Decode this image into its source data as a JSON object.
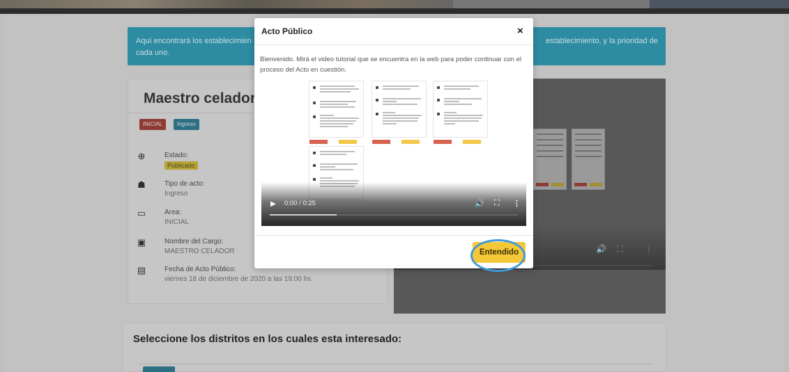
{
  "background": {
    "banner": {
      "text_left": "Aquí encontrará los establecimien",
      "text_left_line2": "cada uno.",
      "text_right": "establecimiento, y la prioridad de"
    },
    "card": {
      "title": "Maestro celador",
      "badges": [
        "INICIAL",
        "Ingreso"
      ],
      "details": [
        {
          "icon": "plus-circle-icon",
          "label": "Estado:",
          "value": "Publicado"
        },
        {
          "icon": "building-icon",
          "label": "Tipo de acto:",
          "value": "Ingreso"
        },
        {
          "icon": "monitor-icon",
          "label": "Area:",
          "value": "INICIAL"
        },
        {
          "icon": "suitcase-icon",
          "label": "Nombre del Cargo:",
          "value": "MAESTRO CELADOR"
        },
        {
          "icon": "calendar-icon",
          "label": "Fecha de Acto Público:",
          "value": "viernes 18 de diciembre de 2020 a las 19:00 hs."
        }
      ]
    },
    "districts_title": "Seleccione los distritos en los cuales esta interesado:"
  },
  "modal": {
    "title": "Acto Público",
    "close_label": "×",
    "body_text": "Bienvenido. Mirá el video tutorial que se encuentra en la web para poder continuar con el proceso del Acto en cuestión.",
    "video": {
      "time": "0:00 / 0:25",
      "progress_buffered": 0.27
    },
    "confirm_label": "Entendido"
  },
  "colors": {
    "accent_yellow": "#f5c83a",
    "highlight_ring": "#3d9bd8"
  }
}
